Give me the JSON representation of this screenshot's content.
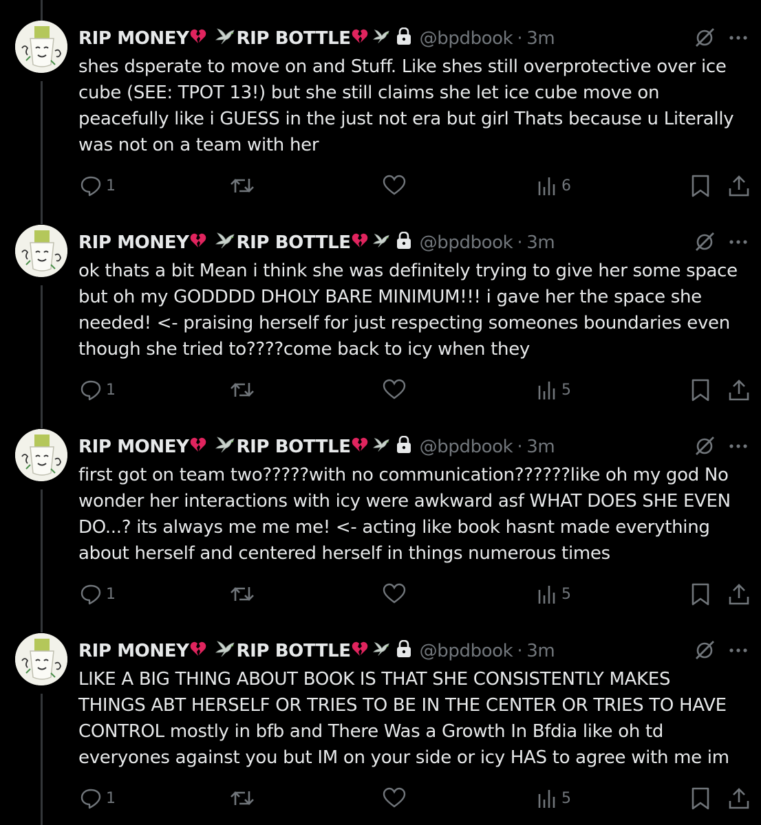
{
  "colors": {
    "background": "#000000",
    "text": "#e7e9ea",
    "muted": "#71767b",
    "thread_line": "#333639",
    "heart": "#e0245e"
  },
  "tweets": [
    {
      "name_part1": "RIP MONEY",
      "name_part2": "RIP BOTTLE",
      "handle": "@bpdbook",
      "separator": "·",
      "time": "3m",
      "text": "shes dsperate to move on and Stuff. Like shes still overprotective over ice\ncube (SEE: TPOT 13!) but she still claims she let ice cube move on\npeacefully like i GUESS in the just not era but girl Thats because u Literally\nwas not on a team with her",
      "replies": "1",
      "views": "6"
    },
    {
      "name_part1": "RIP MONEY",
      "name_part2": "RIP BOTTLE",
      "handle": "@bpdbook",
      "separator": "·",
      "time": "3m",
      "text": "ok thats a bit Mean i think she was definitely trying to give her some space\nbut oh my GODDDD DHOLY BARE MINIMUM!!! i gave her the space she\nneeded! <- praising herself for just respecting someones boundaries even\nthough she tried to????come back to icy when they",
      "replies": "1",
      "views": "5"
    },
    {
      "name_part1": "RIP MONEY",
      "name_part2": "RIP BOTTLE",
      "handle": "@bpdbook",
      "separator": "·",
      "time": "3m",
      "text": "first got on team two?????with no communication??????like oh my god No\nwonder her interactions with icy were awkward asf WHAT DOES SHE EVEN\nDO...? its always me me me! <- acting like book hasnt made everything\nabout herself and centered herself in things numerous times",
      "replies": "1",
      "views": "5"
    },
    {
      "name_part1": "RIP MONEY",
      "name_part2": "RIP BOTTLE",
      "handle": "@bpdbook",
      "separator": "·",
      "time": "3m",
      "text": "LIKE A BIG THING ABOUT BOOK IS THAT SHE CONSISTENTLY MAKES\nTHINGS ABT HERSELF OR TRIES TO BE IN THE CENTER OR TRIES TO HAVE\nCONTROL mostly in bfb and There Was a Growth In Bfdia like oh td\neveryones against you but IM on your side or icy HAS to agree with me im",
      "replies": "1",
      "views": "5"
    }
  ]
}
